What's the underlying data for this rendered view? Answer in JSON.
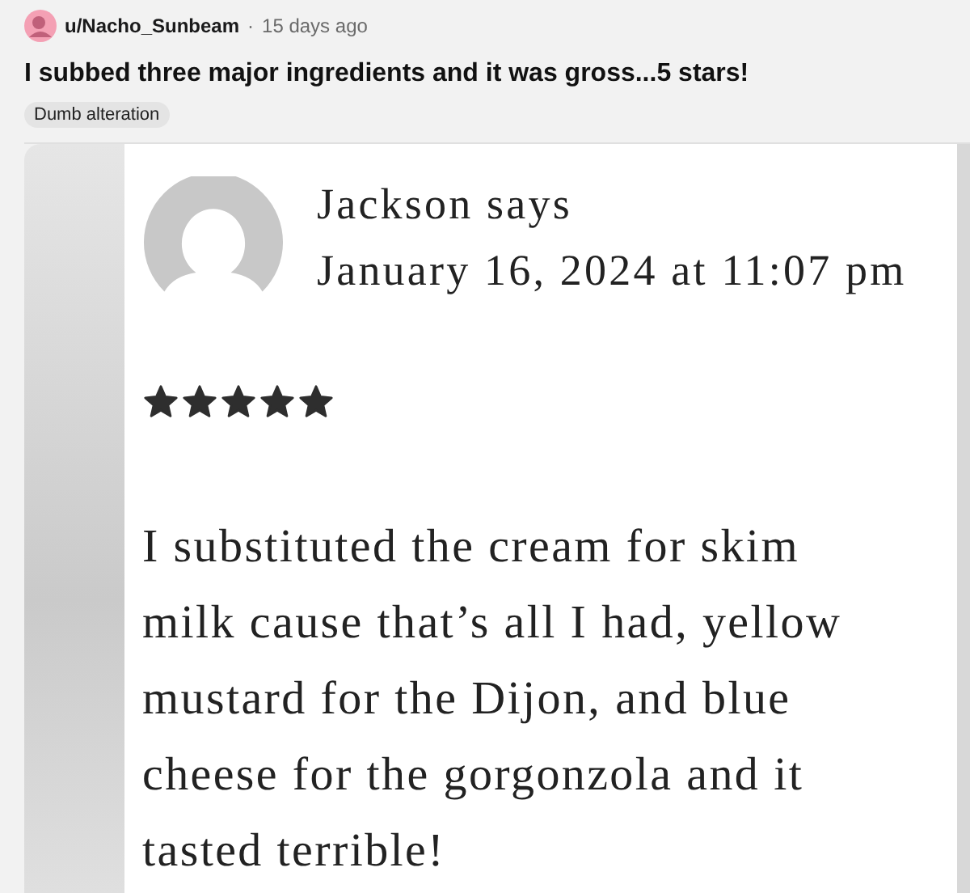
{
  "post": {
    "author": "u/Nacho_Sunbeam",
    "separator": "·",
    "time": "15 days ago",
    "title": "I subbed three major ingredients and it was gross...5 stars!",
    "flair": "Dumb alteration"
  },
  "comment": {
    "kind": "picture_of_comment",
    "commenter": "Jackson says",
    "date": "January 16, 2024 at 11:07 pm",
    "stars": 5,
    "body": "I substituted the cream for skim milk cause that’s all I had, yellow mustard for the Dijon, and blue cheese for the gorgonzola and it tasted terrible!"
  }
}
